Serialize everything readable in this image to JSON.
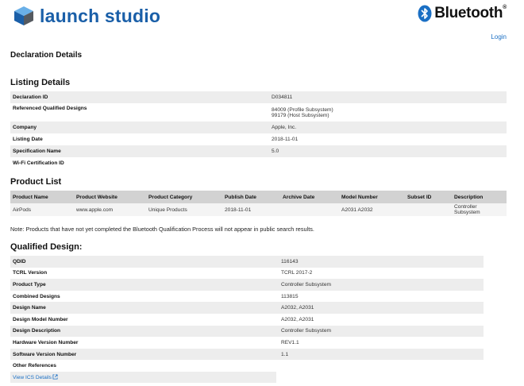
{
  "header": {
    "brand_name": "launch studio",
    "bluetooth_name": "Bluetooth",
    "bluetooth_reg": "®",
    "login_label": "Login",
    "colors": {
      "brand_blue": "#1a5fa8",
      "link_blue": "#1a6fc4"
    }
  },
  "page_title": "Declaration Details",
  "listing": {
    "title": "Listing Details",
    "rows": [
      {
        "key": "Declaration ID",
        "value": [
          "D034811"
        ]
      },
      {
        "key": "Referenced Qualified Designs",
        "value": [
          "84009 (Profile Subsystem)",
          "99179 (Host Subsystem)"
        ]
      },
      {
        "key": "Company",
        "value": [
          "Apple, Inc."
        ]
      },
      {
        "key": "Listing Date",
        "value": [
          "2018-11-01"
        ]
      },
      {
        "key": "Specification Name",
        "value": [
          "5.0"
        ]
      },
      {
        "key": "Wi-Fi Certification ID",
        "value": [
          ""
        ]
      }
    ]
  },
  "product_list": {
    "title": "Product List",
    "columns": [
      "Product Name",
      "Product Website",
      "Product Category",
      "Publish Date",
      "Archive Date",
      "Model Number",
      "Subset ID",
      "Description"
    ],
    "rows": [
      [
        "AirPods",
        "www.apple.com",
        "Unique Products",
        "2018-11-01",
        "",
        "A2031 A2032",
        "",
        "Controller Subsystem"
      ]
    ]
  },
  "note": "Note: Products that have not yet completed the Bluetooth Qualification Process will not appear in public search results.",
  "qualified": {
    "title": "Qualified Design:",
    "rows": [
      {
        "key": "QDID",
        "value": "116143"
      },
      {
        "key": "TCRL Version",
        "value": "TCRL 2017-2"
      },
      {
        "key": "Product Type",
        "value": "Controller Subsystem"
      },
      {
        "key": "Combined Designs",
        "value": "113815"
      },
      {
        "key": "Design Name",
        "value": "A2032, A2031"
      },
      {
        "key": "Design Model Number",
        "value": "A2032, A2031"
      },
      {
        "key": "Design Description",
        "value": "Controller Subsystem"
      },
      {
        "key": "Hardware Version Number",
        "value": "REV1.1"
      },
      {
        "key": "Software Version Number",
        "value": "1.1"
      },
      {
        "key": "Other References",
        "value": ""
      }
    ],
    "ics_link_label": "View ICS Details"
  }
}
